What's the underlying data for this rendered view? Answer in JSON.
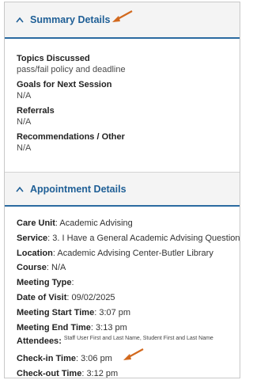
{
  "summary": {
    "header_title": "Summary Details",
    "fields": [
      {
        "label": "Topics Discussed",
        "value": "pass/fail policy and deadline"
      },
      {
        "label": "Goals for Next Session",
        "value": "N/A"
      },
      {
        "label": "Referrals",
        "value": "N/A"
      },
      {
        "label": "Recommendations / Other",
        "value": "N/A"
      }
    ]
  },
  "appointment": {
    "header_title": "Appointment Details",
    "care_unit": {
      "label": "Care Unit",
      "value": "Academic Advising"
    },
    "service": {
      "label": "Service",
      "value": "3. I Have a General Academic Advising Question"
    },
    "location": {
      "label": "Location",
      "value": "Academic Advising Center-Butler Library"
    },
    "course": {
      "label": "Course",
      "value": "N/A"
    },
    "meeting_type": {
      "label": "Meeting Type",
      "value": ""
    },
    "date_of_visit": {
      "label": "Date of Visit",
      "value": "09/02/2025"
    },
    "meeting_start": {
      "label": "Meeting Start Time",
      "value": "3:07 pm"
    },
    "meeting_end": {
      "label": "Meeting End Time",
      "value": "3:13 pm"
    },
    "attendees": {
      "label": "Attendees",
      "value": "Staff User First and Last Name, Student First and Last Name"
    },
    "check_in": {
      "label": "Check-in Time",
      "value": "3:06 pm"
    },
    "check_out": {
      "label": "Check-out Time",
      "value": "3:12 pm"
    }
  },
  "colors": {
    "accent": "#1f5f96",
    "annotation_arrow": "#d2691e",
    "header_bg": "#f4f4f4"
  },
  "icons": {
    "collapse": "chevron-up-icon",
    "annotation": "annotation-arrow-icon"
  }
}
